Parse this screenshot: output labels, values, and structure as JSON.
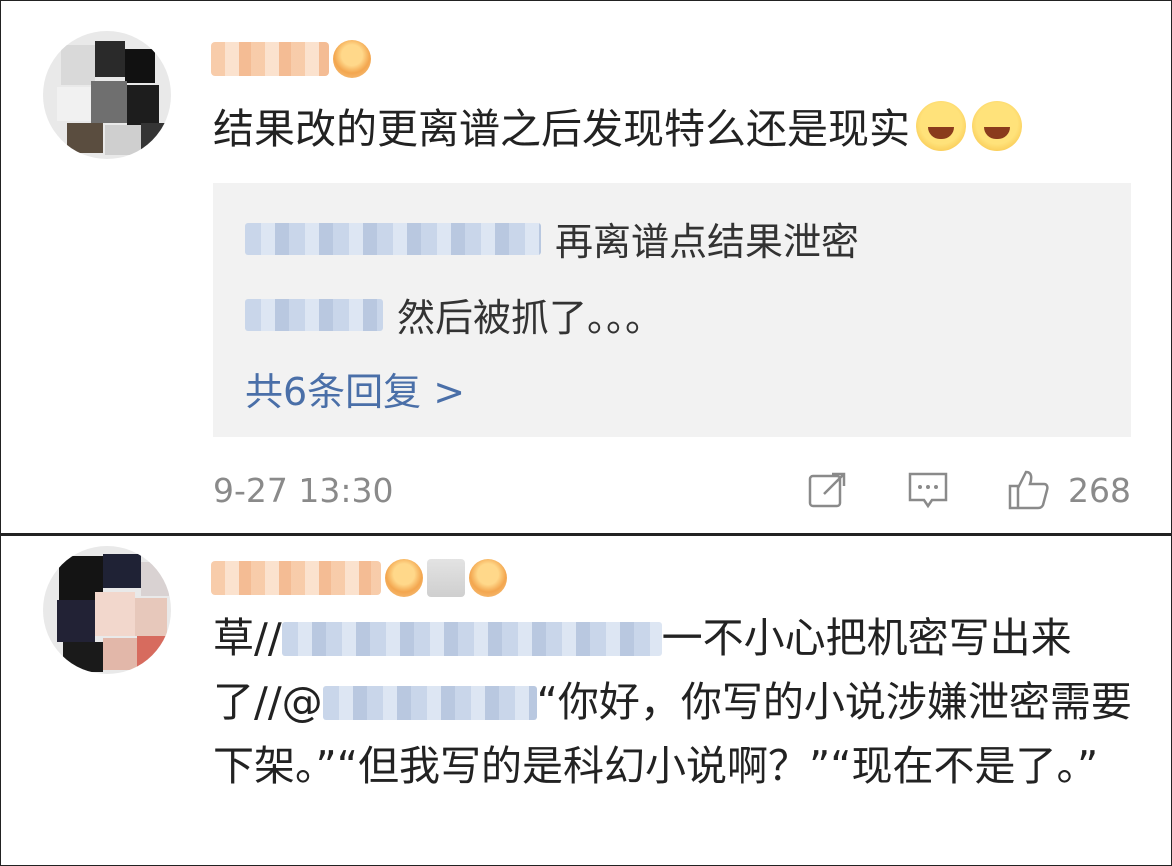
{
  "comments": [
    {
      "text": "结果改的更离谱之后发现特么还是现实",
      "emoji": [
        "laugh-cry-emoji",
        "laugh-cry-emoji"
      ],
      "replies": [
        {
          "text": "再离谱点结果泄密"
        },
        {
          "text": "然后被抓了。。。"
        }
      ],
      "more_replies": "共6条回复 >",
      "time": "9-27 13:30",
      "like_count": "268"
    },
    {
      "text_parts": [
        "一不小心把机密写出来了",
        "“你好，你写的小说涉嫌泄密需要下架。”“但我写的是科幻小说啊？”“现在不是了。”"
      ],
      "prefix": "草//",
      "prefix2": "//@"
    }
  ],
  "colors": {
    "accent_link": "#4a6fa8",
    "meta_gray": "#8a8a8a",
    "reply_bg": "#f2f2f2"
  },
  "icons": [
    "share-icon",
    "comment-icon",
    "like-icon"
  ]
}
